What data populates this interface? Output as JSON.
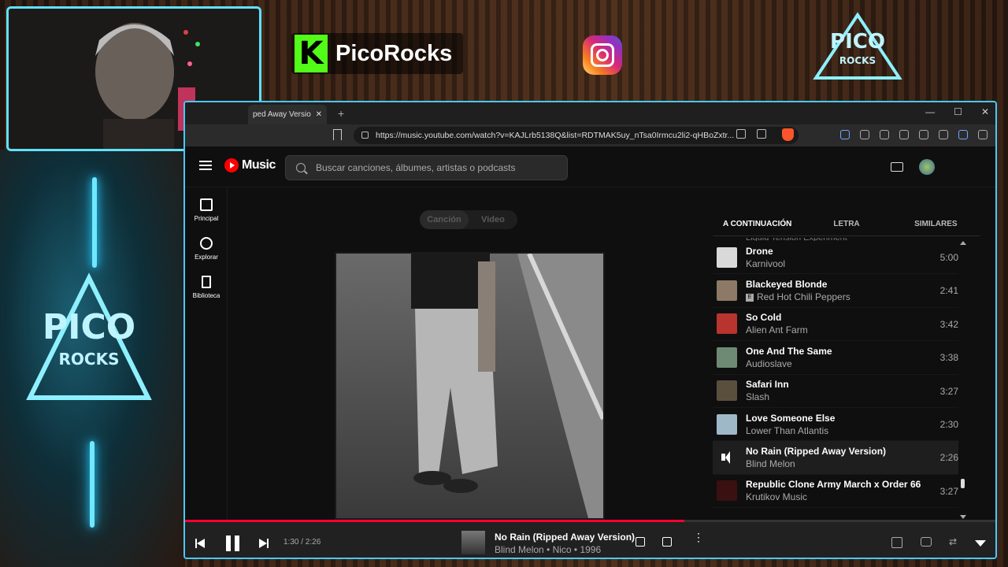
{
  "overlay": {
    "brand_name": "PicoRocks",
    "brand_letter": "K",
    "logo_word_top": "PICO",
    "logo_word_bottom": "ROCKS"
  },
  "browser": {
    "tab_title": "ped Away Versio",
    "new_tab": "+",
    "url": "https://music.youtube.com/watch?v=KAJLrb5138Q&list=RDTMAK5uy_nTsa0Irmcu2li2-qHBoZxtr..."
  },
  "ytm": {
    "logo_text": "Music",
    "search_placeholder": "Buscar canciones, álbumes, artistas o podcasts",
    "nav": [
      {
        "label": "Principal",
        "icon": "home-icon"
      },
      {
        "label": "Explorar",
        "icon": "compass-icon"
      },
      {
        "label": "Biblioteca",
        "icon": "library-icon"
      }
    ],
    "toggle": [
      "Canción",
      "Video"
    ],
    "right_tabs": [
      "A CONTINUACIÓN",
      "LETRA",
      "SIMILARES"
    ],
    "queue_partial": "Liquid Tension Experiment",
    "queue": [
      {
        "title": "Drone",
        "artist": "Karnivool",
        "duration": "5:00",
        "explicit": false,
        "color": "#d9d9d9"
      },
      {
        "title": "Blackeyed Blonde",
        "artist": "Red Hot Chili Peppers",
        "duration": "2:41",
        "explicit": true,
        "color": "#8c7a66"
      },
      {
        "title": "So Cold",
        "artist": "Alien Ant Farm",
        "duration": "3:42",
        "explicit": false,
        "color": "#b8342f"
      },
      {
        "title": "One And The Same",
        "artist": "Audioslave",
        "duration": "3:38",
        "explicit": false,
        "color": "#6e8a74"
      },
      {
        "title": "Safari Inn",
        "artist": "Slash",
        "duration": "3:27",
        "explicit": false,
        "color": "#5a4f3d"
      },
      {
        "title": "Love Someone Else",
        "artist": "Lower Than Atlantis",
        "duration": "2:30",
        "explicit": false,
        "color": "#9fb8c8"
      },
      {
        "title": "No Rain (Ripped Away Version)",
        "artist": "Blind Melon",
        "duration": "2:26",
        "explicit": false,
        "current": true
      },
      {
        "title": "Republic Clone Army March x Order 66",
        "artist": "Krutikov Music",
        "duration": "3:27",
        "explicit": false,
        "color": "#3a1010"
      }
    ],
    "player": {
      "time": "1:30 / 2:26",
      "title": "No Rain (Ripped Away Version)",
      "subtitle": "Blind Melon • Nico • 1996",
      "progress": 0.616
    }
  }
}
